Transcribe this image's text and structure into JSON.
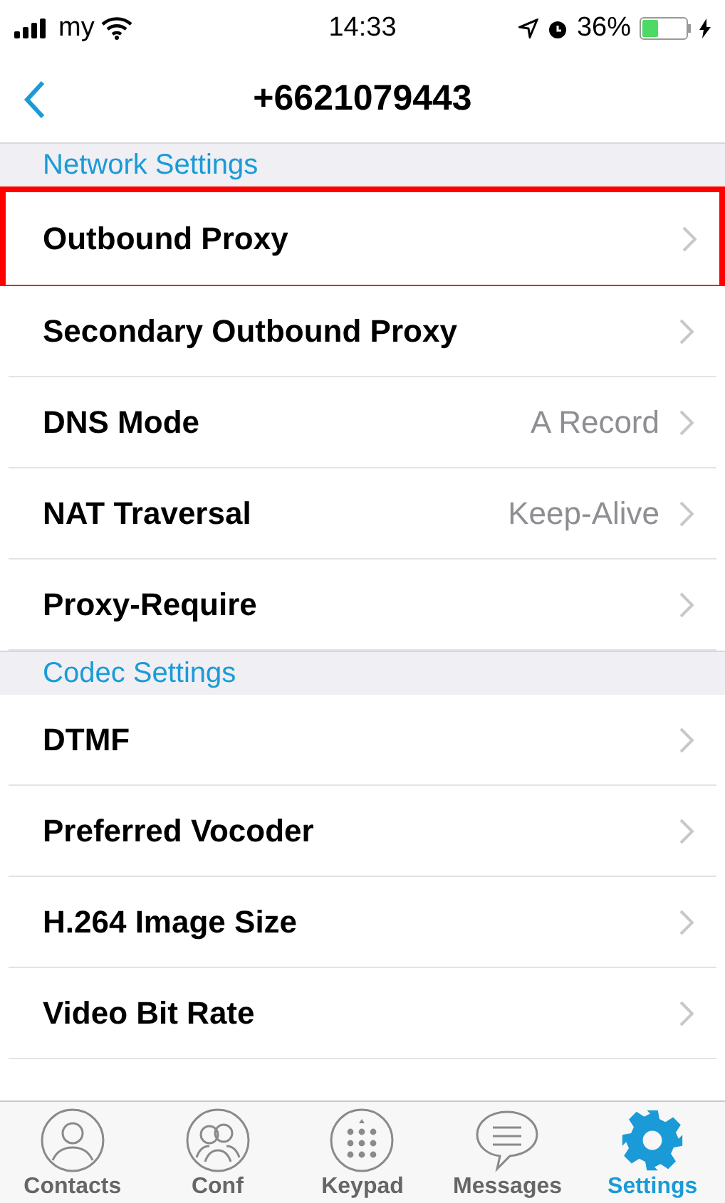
{
  "status_bar": {
    "carrier": "my",
    "time": "14:33",
    "battery": "36%"
  },
  "nav": {
    "title": "+6621079443"
  },
  "items": [
    {
      "kind": "header",
      "label": "Network Settings"
    },
    {
      "kind": "row",
      "label": "Outbound Proxy",
      "highlighted": true
    },
    {
      "kind": "row",
      "label": "Secondary Outbound Proxy",
      "highlighted": false
    },
    {
      "kind": "row",
      "label": "DNS Mode",
      "value": "A Record",
      "highlighted": false
    },
    {
      "kind": "row",
      "label": "NAT Traversal",
      "value": "Keep-Alive",
      "highlighted": false
    },
    {
      "kind": "row",
      "label": "Proxy-Require",
      "highlighted": false
    },
    {
      "kind": "header",
      "label": "Codec Settings"
    },
    {
      "kind": "row",
      "label": "DTMF",
      "highlighted": false
    },
    {
      "kind": "row",
      "label": "Preferred Vocoder",
      "highlighted": false
    },
    {
      "kind": "row",
      "label": "H.264 Image Size",
      "highlighted": false
    },
    {
      "kind": "row",
      "label": "Video Bit Rate",
      "highlighted": false
    }
  ],
  "tabs": [
    {
      "kind": "contacts",
      "label": "Contacts",
      "selected": false
    },
    {
      "kind": "conf",
      "label": "Conf",
      "selected": false
    },
    {
      "kind": "keypad",
      "label": "Keypad",
      "selected": false
    },
    {
      "kind": "messages",
      "label": "Messages",
      "selected": false
    },
    {
      "kind": "settings",
      "label": "Settings",
      "selected": true
    }
  ]
}
